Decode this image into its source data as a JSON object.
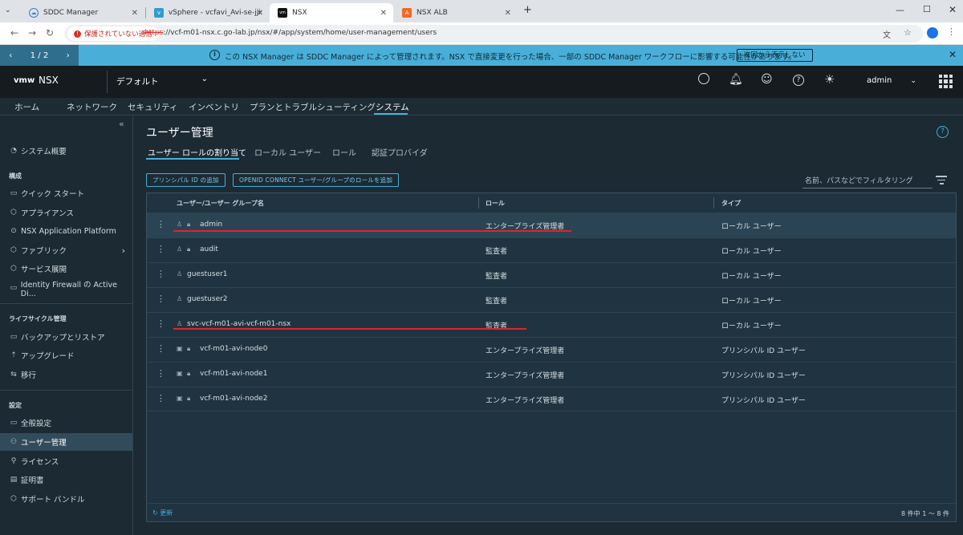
{
  "browser": {
    "tabs": [
      {
        "title": "SDDC Manager"
      },
      {
        "title": "vSphere - vcfavi_Avi-se-jjiso - "
      },
      {
        "title": "NSX"
      },
      {
        "title": "NSX ALB"
      }
    ],
    "security_warning": "保護されていない通信",
    "url_scheme": "https",
    "url_rest": "://vcf-m01-nsx.c.go-lab.jp/nsx/#/app/system/home/user-management/users"
  },
  "banner": {
    "page": "1 / 2",
    "message": "この NSX Manager は SDDC Manager によって管理されます。NSX で直接変更を行った場合、一部の SDDC Manager ワークフローに影響する可能性があります。",
    "hide_button": "次回から表示しない"
  },
  "header": {
    "logo": "vmw",
    "product": "NSX",
    "context": "デフォルト",
    "user": "admin"
  },
  "topnav": [
    "ホーム",
    "ネットワーク",
    "セキュリティ",
    "インベントリ",
    "プランとトラブルシューティング",
    "システム"
  ],
  "sidebar": {
    "item0": "システム概要",
    "sec1": "構成",
    "items1": [
      "クイック スタート",
      "アプライアンス",
      "NSX Application Platform",
      "ファブリック",
      "サービス展開",
      "Identity Firewall の Active Di..."
    ],
    "sec2": "ライフサイクル管理",
    "items2": [
      "バックアップとリストア",
      "アップグレード",
      "移行"
    ],
    "sec3": "設定",
    "items3": [
      "全般設定",
      "ユーザー管理",
      "ライセンス",
      "証明書",
      "サポート バンドル"
    ]
  },
  "main": {
    "title": "ユーザー管理",
    "subtabs": [
      "ユーザー ロールの割り当て",
      "ローカル ユーザー",
      "ロール",
      "認証プロバイダ"
    ],
    "btn_principal": "プリンシパル ID の追加",
    "btn_oidc": "OPENID CONNECT ユーザー/グループのロールを追加",
    "filter_placeholder": "名前、パスなどでフィルタリング",
    "columns": [
      "ユーザー/ユーザー グループ名",
      "ロール",
      "タイプ"
    ],
    "rows": [
      {
        "name": "admin",
        "role": "エンタープライズ管理者",
        "type": "ローカル ユーザー"
      },
      {
        "name": "audit",
        "role": "監査者",
        "type": "ローカル ユーザー"
      },
      {
        "name": "guestuser1",
        "role": "監査者",
        "type": "ローカル ユーザー"
      },
      {
        "name": "guestuser2",
        "role": "監査者",
        "type": "ローカル ユーザー"
      },
      {
        "name": "svc-vcf-m01-avi-vcf-m01-nsx",
        "role": "監査者",
        "type": "ローカル ユーザー"
      },
      {
        "name": "vcf-m01-avi-node0",
        "role": "エンタープライズ管理者",
        "type": "プリンシパル ID ユーザー"
      },
      {
        "name": "vcf-m01-avi-node1",
        "role": "エンタープライズ管理者",
        "type": "プリンシパル ID ユーザー"
      },
      {
        "name": "vcf-m01-avi-node2",
        "role": "エンタープライズ管理者",
        "type": "プリンシパル ID ユーザー"
      }
    ],
    "refresh": "更新",
    "count": "8 件中 1 ～ 8 件"
  },
  "colors": {
    "accent": "#49afd9",
    "highlight": "#e3212f"
  }
}
